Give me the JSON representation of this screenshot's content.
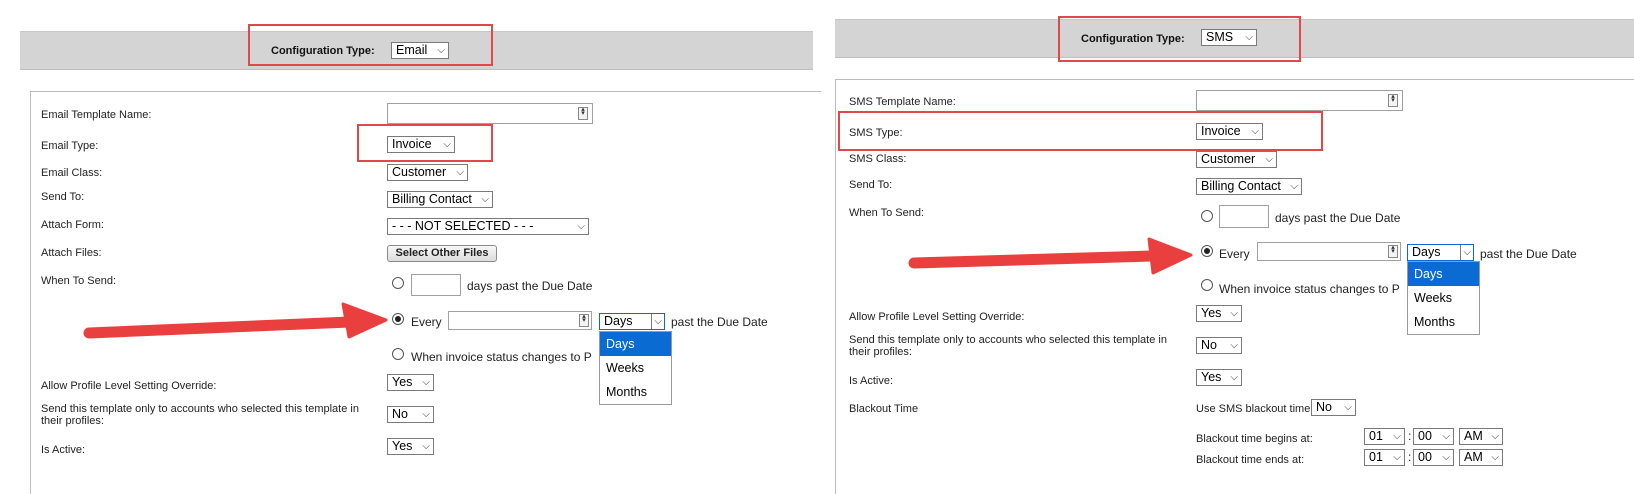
{
  "colors": {
    "highlight": "#e0484b",
    "arrow": "#e9403f",
    "selected_option": "#0a6bd3",
    "header_bar": "#d4d4d4"
  },
  "left": {
    "config_type_label": "Configuration Type:",
    "config_type_value": "Email",
    "labels": {
      "template_name": "Email Template Name:",
      "type": "Email Type:",
      "class": "Email Class:",
      "send_to": "Send To:",
      "attach_form": "Attach Form:",
      "attach_files": "Attach Files:",
      "when_to_send": "When To Send:",
      "allow_override": "Allow Profile Level Setting Override:",
      "send_only": "Send this template only to accounts who selected this template in their profiles:",
      "is_active": "Is Active:"
    },
    "values": {
      "type": "Invoice",
      "class": "Customer",
      "send_to": "Billing Contact",
      "attach_form": "- - - NOT SELECTED - - -",
      "attach_files_button": "Select Other Files",
      "interval_unit": "Days",
      "allow_override": "Yes",
      "send_only": "No",
      "is_active": "Yes"
    },
    "when": {
      "days_past": "days past the Due Date",
      "every": "Every",
      "past_due": "past the Due Date",
      "status_change": "When invoice status changes to P"
    },
    "dropdown_options": [
      "Days",
      "Weeks",
      "Months"
    ]
  },
  "right": {
    "config_type_label": "Configuration Type:",
    "config_type_value": "SMS",
    "labels": {
      "template_name": "SMS Template Name:",
      "type": "SMS Type:",
      "class": "SMS Class:",
      "send_to": "Send To:",
      "when_to_send": "When To Send:",
      "allow_override": "Allow Profile Level Setting Override:",
      "send_only": "Send this template only to accounts who selected this template in their profiles:",
      "is_active": "Is Active:",
      "blackout_time": "Blackout Time",
      "use_blackout": "Use SMS blackout time:",
      "begins": "Blackout time begins at:",
      "ends": "Blackout time ends at:"
    },
    "values": {
      "type": "Invoice",
      "class": "Customer",
      "send_to": "Billing Contact",
      "interval_unit": "Days",
      "allow_override": "Yes",
      "send_only": "No",
      "is_active": "Yes",
      "use_blackout": "No",
      "begin_hour": "01",
      "begin_min": "00",
      "begin_ampm": "AM",
      "end_hour": "01",
      "end_min": "00",
      "end_ampm": "AM"
    },
    "when": {
      "days_past": "days past the Due Date",
      "every": "Every",
      "past_due": "past the Due Date",
      "status_change": "When invoice status changes to P"
    },
    "dropdown_options": [
      "Days",
      "Weeks",
      "Months"
    ]
  }
}
